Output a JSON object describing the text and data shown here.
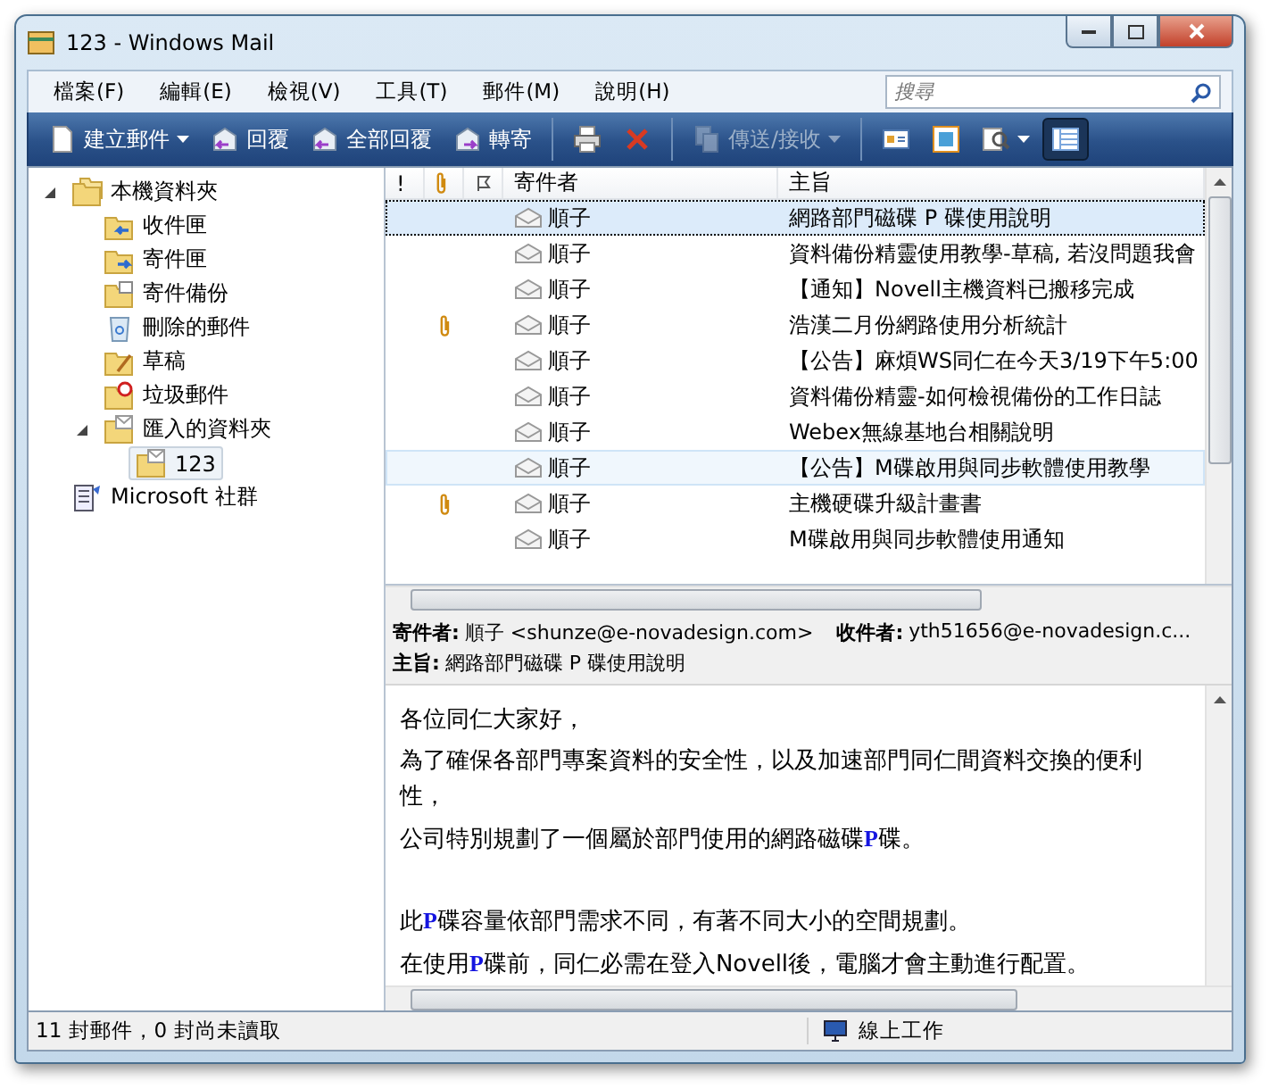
{
  "window": {
    "title": "123 - Windows Mail"
  },
  "menu": [
    "檔案(F)",
    "編輯(E)",
    "檢視(V)",
    "工具(T)",
    "郵件(M)",
    "說明(H)"
  ],
  "search": {
    "placeholder": "搜尋"
  },
  "toolbar": [
    {
      "kind": "new",
      "label": "建立郵件",
      "caret": true,
      "disabled": false,
      "selected": false
    },
    {
      "kind": "reply",
      "label": "回覆",
      "caret": false,
      "disabled": false,
      "selected": false
    },
    {
      "kind": "replyall",
      "label": "全部回覆",
      "caret": false,
      "disabled": false,
      "selected": false
    },
    {
      "kind": "forward",
      "label": "轉寄",
      "caret": false,
      "disabled": false,
      "selected": false
    },
    {
      "kind": "sep"
    },
    {
      "kind": "print",
      "caret": false,
      "disabled": false,
      "selected": false
    },
    {
      "kind": "delete",
      "caret": false,
      "disabled": false,
      "selected": false
    },
    {
      "kind": "sep"
    },
    {
      "kind": "sendrecv",
      "label": "傳送/接收",
      "caret": true,
      "disabled": true,
      "selected": false
    },
    {
      "kind": "sep"
    },
    {
      "kind": "contacts",
      "caret": false,
      "disabled": false,
      "selected": false
    },
    {
      "kind": "calendar",
      "caret": false,
      "disabled": false,
      "selected": false
    },
    {
      "kind": "find",
      "caret": true,
      "disabled": false,
      "selected": false
    },
    {
      "kind": "layout",
      "caret": false,
      "disabled": false,
      "selected": true
    }
  ],
  "folders": [
    {
      "kind": "root",
      "label": "本機資料夾",
      "expanded": true,
      "selected": false,
      "children": [
        {
          "kind": "inbox",
          "label": "收件匣",
          "selected": false
        },
        {
          "kind": "outbox",
          "label": "寄件匣",
          "selected": false
        },
        {
          "kind": "sent",
          "label": "寄件備份",
          "selected": false
        },
        {
          "kind": "trash",
          "label": "刪除的郵件",
          "selected": false
        },
        {
          "kind": "drafts",
          "label": "草稿",
          "selected": false
        },
        {
          "kind": "junk",
          "label": "垃圾郵件",
          "selected": false
        },
        {
          "kind": "folder",
          "label": "匯入的資料夾",
          "expanded": true,
          "selected": false,
          "children": [
            {
              "kind": "folder",
              "label": "123",
              "selected": true
            }
          ]
        }
      ]
    },
    {
      "kind": "community",
      "label": "Microsoft 社群",
      "selected": false
    }
  ],
  "message_list": {
    "columns": [
      "!",
      "寄件者",
      "主旨"
    ],
    "rows": [
      {
        "sender": "順子",
        "subject": "網路部門磁碟 P 碟使用說明",
        "attachment": false,
        "selected": true,
        "hot": false
      },
      {
        "sender": "順子",
        "subject": "資料備份精靈使用教學-草稿, 若沒問題我會",
        "attachment": false,
        "selected": false,
        "hot": false
      },
      {
        "sender": "順子",
        "subject": "【通知】Novell主機資料已搬移完成",
        "attachment": false,
        "selected": false,
        "hot": false
      },
      {
        "sender": "順子",
        "subject": "浩漢二月份網路使用分析統計",
        "attachment": true,
        "selected": false,
        "hot": false
      },
      {
        "sender": "順子",
        "subject": "【公告】麻煩WS同仁在今天3/19下午5:00",
        "attachment": false,
        "selected": false,
        "hot": false
      },
      {
        "sender": "順子",
        "subject": "資料備份精靈-如何檢視備份的工作日誌",
        "attachment": false,
        "selected": false,
        "hot": false
      },
      {
        "sender": "順子",
        "subject": "Webex無線基地台相關說明",
        "attachment": false,
        "selected": false,
        "hot": false
      },
      {
        "sender": "順子",
        "subject": "【公告】M碟啟用與同步軟體使用教學",
        "attachment": false,
        "selected": false,
        "hot": true
      },
      {
        "sender": "順子",
        "subject": "主機硬碟升級計畫書",
        "attachment": true,
        "selected": false,
        "hot": false
      },
      {
        "sender": "順子",
        "subject": "M碟啟用與同步軟體使用通知",
        "attachment": false,
        "selected": false,
        "hot": false
      }
    ]
  },
  "preview": {
    "from_label": "寄件者:",
    "from": "順子 <shunze@e-novadesign.com>",
    "to_label": "收件者:",
    "to": "yth51656@e-novadesign.c...",
    "subject_label": "主旨:",
    "subject": "網路部門磁碟 P 碟使用說明",
    "body": [
      {
        "text": "各位同仁大家好，",
        "space_before": false
      },
      {
        "text": "為了確保各部門專案資料的安全性，以及加速部門同仁間資料交換的便利性，",
        "space_before": false
      },
      {
        "text": "公司特別規劃了一個屬於部門使用的網路磁碟**P**碟。",
        "space_before": false
      },
      {
        "text": "此**P**碟容量依部門需求不同，有著不同大小的空間規劃。",
        "space_before": true
      },
      {
        "text": "在使用**P**碟前，同仁必需在登入Novell後，電腦才會主動進行配置。",
        "space_before": false
      }
    ]
  },
  "status_bar": {
    "count": "11 封郵件，0 封尚未讀取",
    "online": "線上工作"
  }
}
